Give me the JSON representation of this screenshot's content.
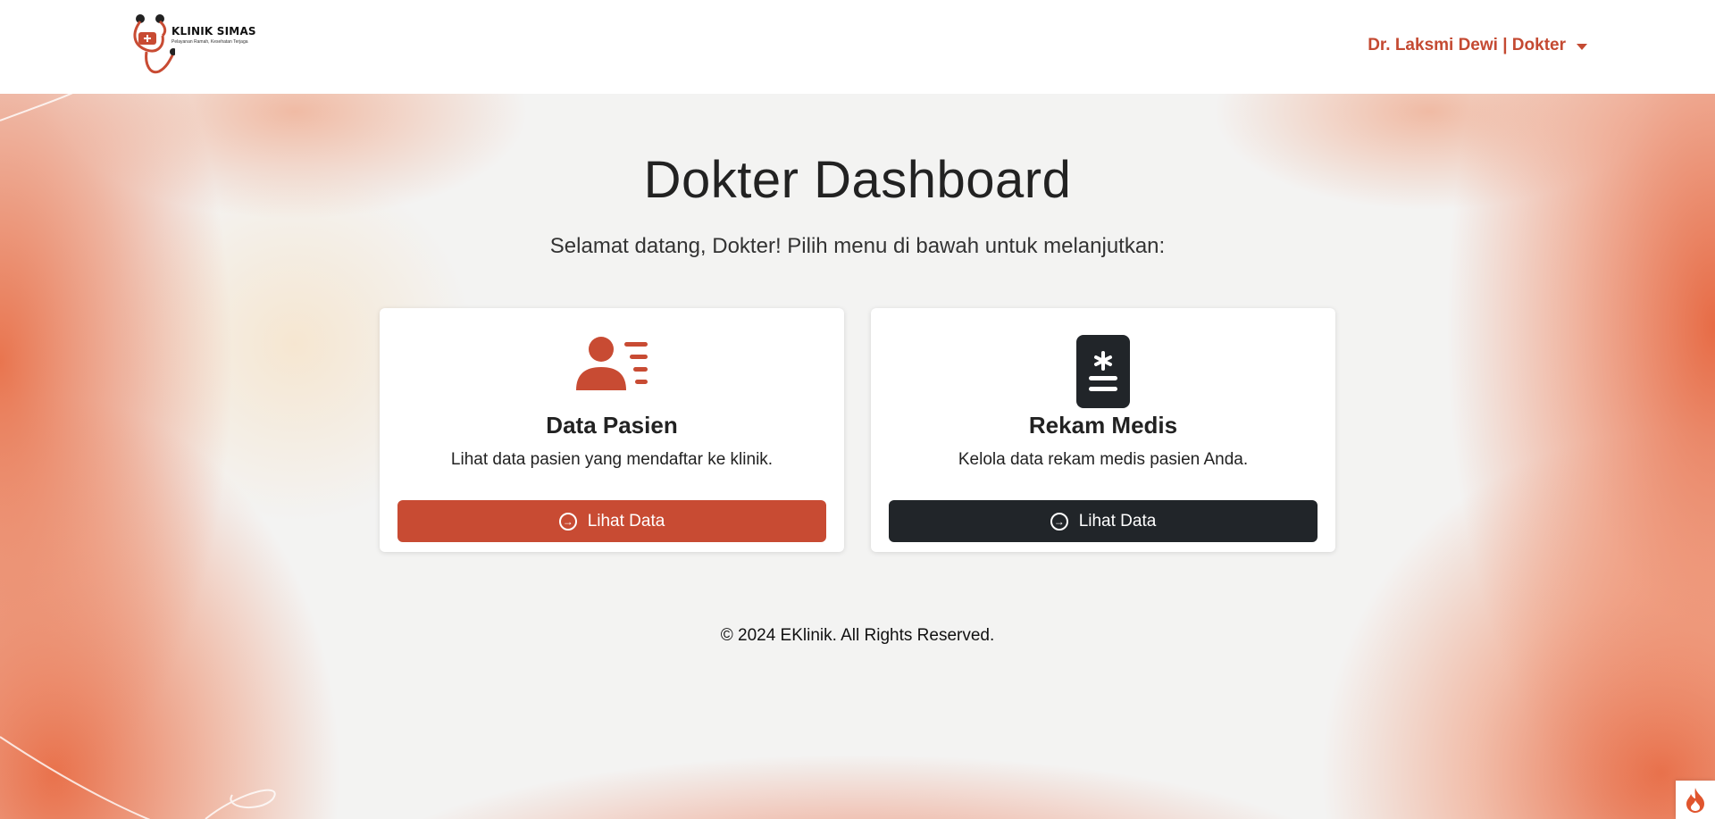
{
  "brand": {
    "name": "KLINIK SIMAS",
    "tagline": "Pelayanan Ramah, Kesehatan Terjaga"
  },
  "navbar": {
    "user_label": "Dr. Laksmi Dewi | Dokter"
  },
  "main": {
    "title": "Dokter Dashboard",
    "subtitle": "Selamat datang, Dokter! Pilih menu di bawah untuk melanjutkan:",
    "cards": [
      {
        "title": "Data Pasien",
        "text": "Lihat data pasien yang mendaftar ke klinik.",
        "button_label": "Lihat Data",
        "icon": "patient-list-icon"
      },
      {
        "title": "Rekam Medis",
        "text": "Kelola data rekam medis pasien Anda.",
        "button_label": "Lihat Data",
        "icon": "medical-record-icon"
      }
    ]
  },
  "footer": {
    "text": "© 2024 EKlinik. All Rights Reserved."
  },
  "colors": {
    "accent": "#c84b33",
    "dark": "#212529"
  }
}
